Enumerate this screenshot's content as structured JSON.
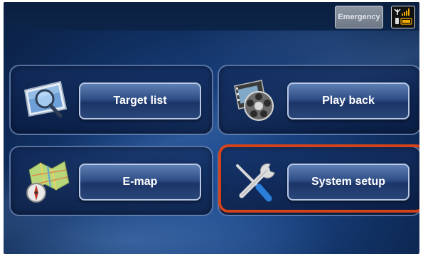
{
  "header": {
    "emergency_label": "Emergency",
    "status_icon": "signal-battery-icon"
  },
  "menu": {
    "items": [
      {
        "label": "Target list",
        "icon": "magnifier-screen-icon"
      },
      {
        "label": "Play back",
        "icon": "film-reel-icon"
      },
      {
        "label": "E-map",
        "icon": "map-compass-icon"
      },
      {
        "label": "System setup",
        "icon": "wrench-screwdriver-icon"
      }
    ]
  },
  "colors": {
    "highlight": "#d2431c",
    "background": "#173e7a",
    "button": "#2e4d85"
  }
}
